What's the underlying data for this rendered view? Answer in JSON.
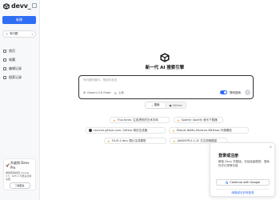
{
  "brand": {
    "name": "devv_",
    "accent": "#2f6df5"
  },
  "sidebar": {
    "new_label": "新建",
    "search_label": "有问题",
    "items": [
      {
        "label": "首页",
        "icon": "home-icon"
      },
      {
        "label": "收藏",
        "icon": "bookmark-icon"
      },
      {
        "label": "编辑记录",
        "icon": "history-icon"
      },
      {
        "label": "搜索记录",
        "icon": "list-icon"
      }
    ],
    "promo": {
      "title": "升级到 Devv Pro",
      "desc": "解锁更强模型 Claude 3.5、GPT-4 与更多高级功能",
      "button": "了解更多"
    }
  },
  "main": {
    "headline": "新一代 AI 搜索引擎",
    "input_placeholder": "有问题尽管问，按回车发送",
    "model": "Gemini 2.0 Flash",
    "upload_label": "上传",
    "toggle_label": "联网搜索",
    "tabs": [
      {
        "label": "搜索",
        "active": true
      },
      {
        "label": "GitHub",
        "active": false
      }
    ],
    "chips": [
      "Flux-fonts: 生成漂亮的艺术字体",
      "Spotify: Spotify 音乐下载器",
      "resume.github.com: GitHub 简历生成器",
      "Mistral-NeMo-Minitron-8B-Base 开源模型",
      "FLUX.1-dev: 图片生成模型",
      "JANGSPR-0.2_B: 文生视频模型"
    ]
  },
  "login": {
    "title": "登录或注册",
    "desc": "解锁 Devv 完整版，包括高级模型、搜索历史记录等功能",
    "google_label": "Continue with Google",
    "link_label": "邮箱或手机号登录"
  }
}
